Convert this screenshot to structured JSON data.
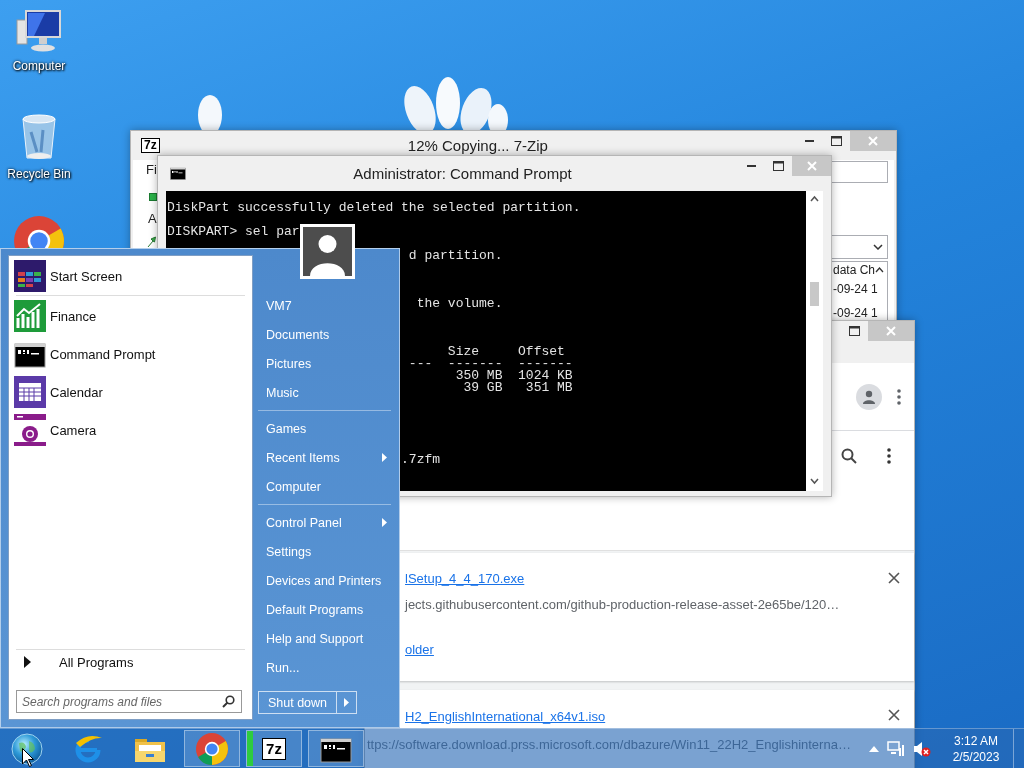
{
  "desktop": {
    "icons": [
      {
        "kind": "computer",
        "label": "Computer"
      },
      {
        "kind": "recycle-bin",
        "label": "Recycle Bin"
      },
      {
        "kind": "chrome"
      }
    ]
  },
  "zip_window": {
    "icon_text": "7z",
    "title": "12% Copying... 7-Zip",
    "menu_fragment": "Fi",
    "toolbar_fragment": "A",
    "list_header": "data Ch",
    "list_rows": [
      "-09-24 1",
      "-09-24 1"
    ]
  },
  "browser_window": {
    "downloads": [
      {
        "file": "lSetup_4_4_170.exe",
        "url": "jects.githubusercontent.com/github-production-release-asset-2e65be/120…",
        "folder_link": "older"
      },
      {
        "file": "H2_EnglishInternational_x64v1.iso",
        "url": "ttps://software.download.prss.microsoft.com/dbazure/Win11_22H2_Englishinterna…"
      }
    ]
  },
  "cmd_window": {
    "title": "Administrator: Command Prompt",
    "lines": [
      "DiskPart successfully deleted the selected partition.",
      "DISKPART> sel par",
      "d partition.",
      "the volume.",
      "Size     Offset",
      "---  -------  -------",
      "350 MB  1024 KB",
      "39 GB   351 MB",
      ".7zfm"
    ]
  },
  "start_menu": {
    "programs": [
      {
        "kind": "start-screen",
        "label": "Start Screen"
      },
      {
        "kind": "finance",
        "label": "Finance"
      },
      {
        "kind": "cmd",
        "label": "Command Prompt"
      },
      {
        "kind": "calendar",
        "label": "Calendar"
      },
      {
        "kind": "camera",
        "label": "Camera"
      }
    ],
    "all_programs": "All Programs",
    "search": {
      "placeholder": "Search programs and files"
    },
    "groups": [
      [
        {
          "label": "VM7",
          "submenu": false
        },
        {
          "label": "Documents",
          "submenu": false
        },
        {
          "label": "Pictures",
          "submenu": false
        },
        {
          "label": "Music",
          "submenu": false
        }
      ],
      [
        {
          "label": "Games",
          "submenu": false
        },
        {
          "label": "Recent Items",
          "submenu": true
        },
        {
          "label": "Computer",
          "submenu": false
        }
      ],
      [
        {
          "label": "Control Panel",
          "submenu": true
        },
        {
          "label": "Settings",
          "submenu": false
        },
        {
          "label": "Devices and Printers",
          "submenu": false
        },
        {
          "label": "Default Programs",
          "submenu": false
        },
        {
          "label": "Help and Support",
          "submenu": false
        },
        {
          "label": "Run...",
          "submenu": false
        }
      ]
    ],
    "shutdown": "Shut down"
  },
  "taskbar": {
    "buttons": [
      {
        "kind": "ie",
        "running": false
      },
      {
        "kind": "explorer",
        "running": false
      },
      {
        "kind": "chrome",
        "running": true
      },
      {
        "kind": "archive",
        "running": true,
        "icon_text": "7z",
        "level": 0.12
      },
      {
        "kind": "cmd",
        "running": true
      }
    ],
    "clock": {
      "time": "3:12 AM",
      "date": "2/5/2023"
    }
  }
}
